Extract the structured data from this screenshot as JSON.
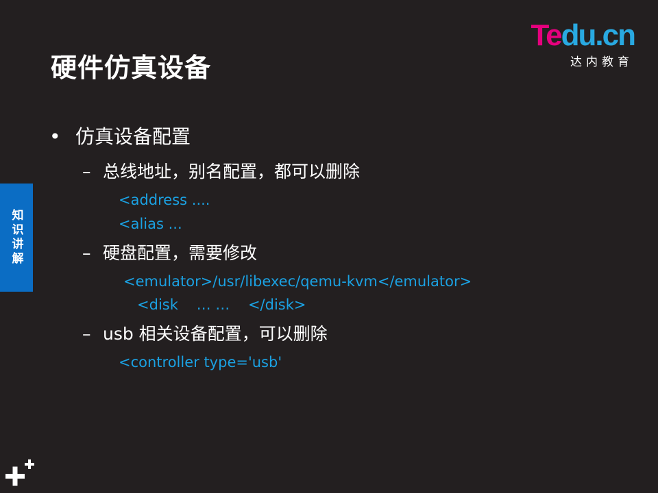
{
  "title": "硬件仿真设备",
  "logo": {
    "t": "T",
    "e": "e",
    "du": "du",
    "cn": ".cn",
    "subtitle": "达内教育"
  },
  "side_tab": "知识讲解",
  "bullets": {
    "main": "仿真设备配置",
    "marker": "•",
    "dash": "–",
    "items": [
      {
        "label": "总线地址，别名配置，都可以删除",
        "code": [
          "<address ....",
          "<alias ..."
        ]
      },
      {
        "label": "硬盘配置，需要修改",
        "code": [
          "<emulator>/usr/libexec/qemu-kvm</emulator>",
          "   <disk    … …    </disk>"
        ]
      },
      {
        "label": "usb 相关设备配置，可以删除",
        "code": [
          "<controller type='usb'"
        ]
      }
    ]
  },
  "colors": {
    "background": "#231f20",
    "code": "#1ba1e2",
    "side_tab": "#0b6dc4",
    "logo_pink": "#e6007e",
    "logo_blue": "#29a9e1"
  },
  "icons": [
    "plus-plus-icon"
  ]
}
